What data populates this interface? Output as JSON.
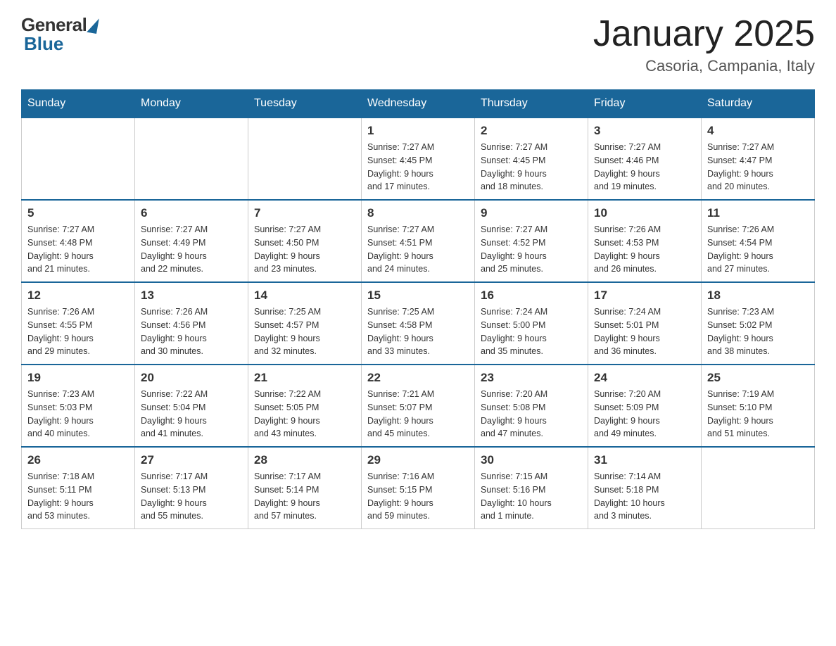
{
  "header": {
    "logo_general": "General",
    "logo_blue": "Blue",
    "month_title": "January 2025",
    "location": "Casoria, Campania, Italy"
  },
  "days_of_week": [
    "Sunday",
    "Monday",
    "Tuesday",
    "Wednesday",
    "Thursday",
    "Friday",
    "Saturday"
  ],
  "weeks": [
    [
      {
        "day": "",
        "info": ""
      },
      {
        "day": "",
        "info": ""
      },
      {
        "day": "",
        "info": ""
      },
      {
        "day": "1",
        "info": "Sunrise: 7:27 AM\nSunset: 4:45 PM\nDaylight: 9 hours\nand 17 minutes."
      },
      {
        "day": "2",
        "info": "Sunrise: 7:27 AM\nSunset: 4:45 PM\nDaylight: 9 hours\nand 18 minutes."
      },
      {
        "day": "3",
        "info": "Sunrise: 7:27 AM\nSunset: 4:46 PM\nDaylight: 9 hours\nand 19 minutes."
      },
      {
        "day": "4",
        "info": "Sunrise: 7:27 AM\nSunset: 4:47 PM\nDaylight: 9 hours\nand 20 minutes."
      }
    ],
    [
      {
        "day": "5",
        "info": "Sunrise: 7:27 AM\nSunset: 4:48 PM\nDaylight: 9 hours\nand 21 minutes."
      },
      {
        "day": "6",
        "info": "Sunrise: 7:27 AM\nSunset: 4:49 PM\nDaylight: 9 hours\nand 22 minutes."
      },
      {
        "day": "7",
        "info": "Sunrise: 7:27 AM\nSunset: 4:50 PM\nDaylight: 9 hours\nand 23 minutes."
      },
      {
        "day": "8",
        "info": "Sunrise: 7:27 AM\nSunset: 4:51 PM\nDaylight: 9 hours\nand 24 minutes."
      },
      {
        "day": "9",
        "info": "Sunrise: 7:27 AM\nSunset: 4:52 PM\nDaylight: 9 hours\nand 25 minutes."
      },
      {
        "day": "10",
        "info": "Sunrise: 7:26 AM\nSunset: 4:53 PM\nDaylight: 9 hours\nand 26 minutes."
      },
      {
        "day": "11",
        "info": "Sunrise: 7:26 AM\nSunset: 4:54 PM\nDaylight: 9 hours\nand 27 minutes."
      }
    ],
    [
      {
        "day": "12",
        "info": "Sunrise: 7:26 AM\nSunset: 4:55 PM\nDaylight: 9 hours\nand 29 minutes."
      },
      {
        "day": "13",
        "info": "Sunrise: 7:26 AM\nSunset: 4:56 PM\nDaylight: 9 hours\nand 30 minutes."
      },
      {
        "day": "14",
        "info": "Sunrise: 7:25 AM\nSunset: 4:57 PM\nDaylight: 9 hours\nand 32 minutes."
      },
      {
        "day": "15",
        "info": "Sunrise: 7:25 AM\nSunset: 4:58 PM\nDaylight: 9 hours\nand 33 minutes."
      },
      {
        "day": "16",
        "info": "Sunrise: 7:24 AM\nSunset: 5:00 PM\nDaylight: 9 hours\nand 35 minutes."
      },
      {
        "day": "17",
        "info": "Sunrise: 7:24 AM\nSunset: 5:01 PM\nDaylight: 9 hours\nand 36 minutes."
      },
      {
        "day": "18",
        "info": "Sunrise: 7:23 AM\nSunset: 5:02 PM\nDaylight: 9 hours\nand 38 minutes."
      }
    ],
    [
      {
        "day": "19",
        "info": "Sunrise: 7:23 AM\nSunset: 5:03 PM\nDaylight: 9 hours\nand 40 minutes."
      },
      {
        "day": "20",
        "info": "Sunrise: 7:22 AM\nSunset: 5:04 PM\nDaylight: 9 hours\nand 41 minutes."
      },
      {
        "day": "21",
        "info": "Sunrise: 7:22 AM\nSunset: 5:05 PM\nDaylight: 9 hours\nand 43 minutes."
      },
      {
        "day": "22",
        "info": "Sunrise: 7:21 AM\nSunset: 5:07 PM\nDaylight: 9 hours\nand 45 minutes."
      },
      {
        "day": "23",
        "info": "Sunrise: 7:20 AM\nSunset: 5:08 PM\nDaylight: 9 hours\nand 47 minutes."
      },
      {
        "day": "24",
        "info": "Sunrise: 7:20 AM\nSunset: 5:09 PM\nDaylight: 9 hours\nand 49 minutes."
      },
      {
        "day": "25",
        "info": "Sunrise: 7:19 AM\nSunset: 5:10 PM\nDaylight: 9 hours\nand 51 minutes."
      }
    ],
    [
      {
        "day": "26",
        "info": "Sunrise: 7:18 AM\nSunset: 5:11 PM\nDaylight: 9 hours\nand 53 minutes."
      },
      {
        "day": "27",
        "info": "Sunrise: 7:17 AM\nSunset: 5:13 PM\nDaylight: 9 hours\nand 55 minutes."
      },
      {
        "day": "28",
        "info": "Sunrise: 7:17 AM\nSunset: 5:14 PM\nDaylight: 9 hours\nand 57 minutes."
      },
      {
        "day": "29",
        "info": "Sunrise: 7:16 AM\nSunset: 5:15 PM\nDaylight: 9 hours\nand 59 minutes."
      },
      {
        "day": "30",
        "info": "Sunrise: 7:15 AM\nSunset: 5:16 PM\nDaylight: 10 hours\nand 1 minute."
      },
      {
        "day": "31",
        "info": "Sunrise: 7:14 AM\nSunset: 5:18 PM\nDaylight: 10 hours\nand 3 minutes."
      },
      {
        "day": "",
        "info": ""
      }
    ]
  ]
}
